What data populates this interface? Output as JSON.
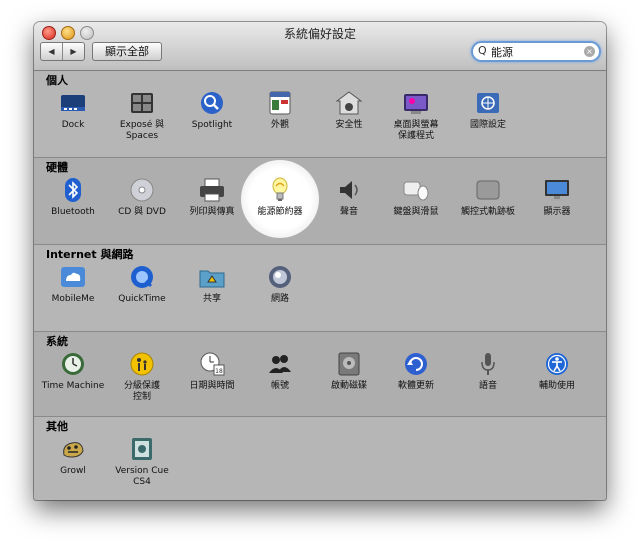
{
  "window": {
    "title": "系統偏好設定"
  },
  "toolbar": {
    "back_symbol": "◀",
    "forward_symbol": "▶",
    "show_all_label": "顯示全部",
    "search_value": "能源",
    "search_icon": "Q"
  },
  "sections": [
    {
      "title": "個人",
      "items": [
        {
          "label": "Dock",
          "icon": "dock-icon"
        },
        {
          "label": "Exposé 與\nSpaces",
          "icon": "expose-spaces-icon"
        },
        {
          "label": "Spotlight",
          "icon": "spotlight-icon"
        },
        {
          "label": "外觀",
          "icon": "appearance-icon"
        },
        {
          "label": "安全性",
          "icon": "security-icon"
        },
        {
          "label": "桌面與螢幕\n保護程式",
          "icon": "desktop-screensaver-icon"
        },
        {
          "label": "國際設定",
          "icon": "international-icon"
        }
      ]
    },
    {
      "title": "硬體",
      "items": [
        {
          "label": "Bluetooth",
          "icon": "bluetooth-icon"
        },
        {
          "label": "CD 與 DVD",
          "icon": "cd-dvd-icon"
        },
        {
          "label": "列印與傳真",
          "icon": "printer-icon"
        },
        {
          "label": "能源節約器",
          "icon": "energy-saver-icon"
        },
        {
          "label": "聲音",
          "icon": "sound-icon"
        },
        {
          "label": "鍵盤與滑鼠",
          "icon": "keyboard-mouse-icon"
        },
        {
          "label": "觸控式軌跡板",
          "icon": "trackpad-icon"
        },
        {
          "label": "顯示器",
          "icon": "display-icon"
        }
      ]
    },
    {
      "title": "Internet 與網路",
      "items": [
        {
          "label": "MobileMe",
          "icon": "mobileme-icon"
        },
        {
          "label": "QuickTime",
          "icon": "quicktime-icon"
        },
        {
          "label": "共享",
          "icon": "sharing-icon"
        },
        {
          "label": "網路",
          "icon": "network-icon"
        }
      ]
    },
    {
      "title": "系統",
      "items": [
        {
          "label": "Time Machine",
          "icon": "time-machine-icon"
        },
        {
          "label": "分級保護\n控制",
          "icon": "parental-controls-icon"
        },
        {
          "label": "日期與時間",
          "icon": "date-time-icon"
        },
        {
          "label": "帳號",
          "icon": "accounts-icon"
        },
        {
          "label": "啟動磁碟",
          "icon": "startup-disk-icon"
        },
        {
          "label": "軟體更新",
          "icon": "software-update-icon"
        },
        {
          "label": "語音",
          "icon": "speech-icon"
        },
        {
          "label": "輔助使用",
          "icon": "universal-access-icon"
        }
      ]
    },
    {
      "title": "其他",
      "items": [
        {
          "label": "Growl",
          "icon": "growl-icon"
        },
        {
          "label": "Version Cue\nCS4",
          "icon": "version-cue-icon"
        }
      ]
    }
  ]
}
